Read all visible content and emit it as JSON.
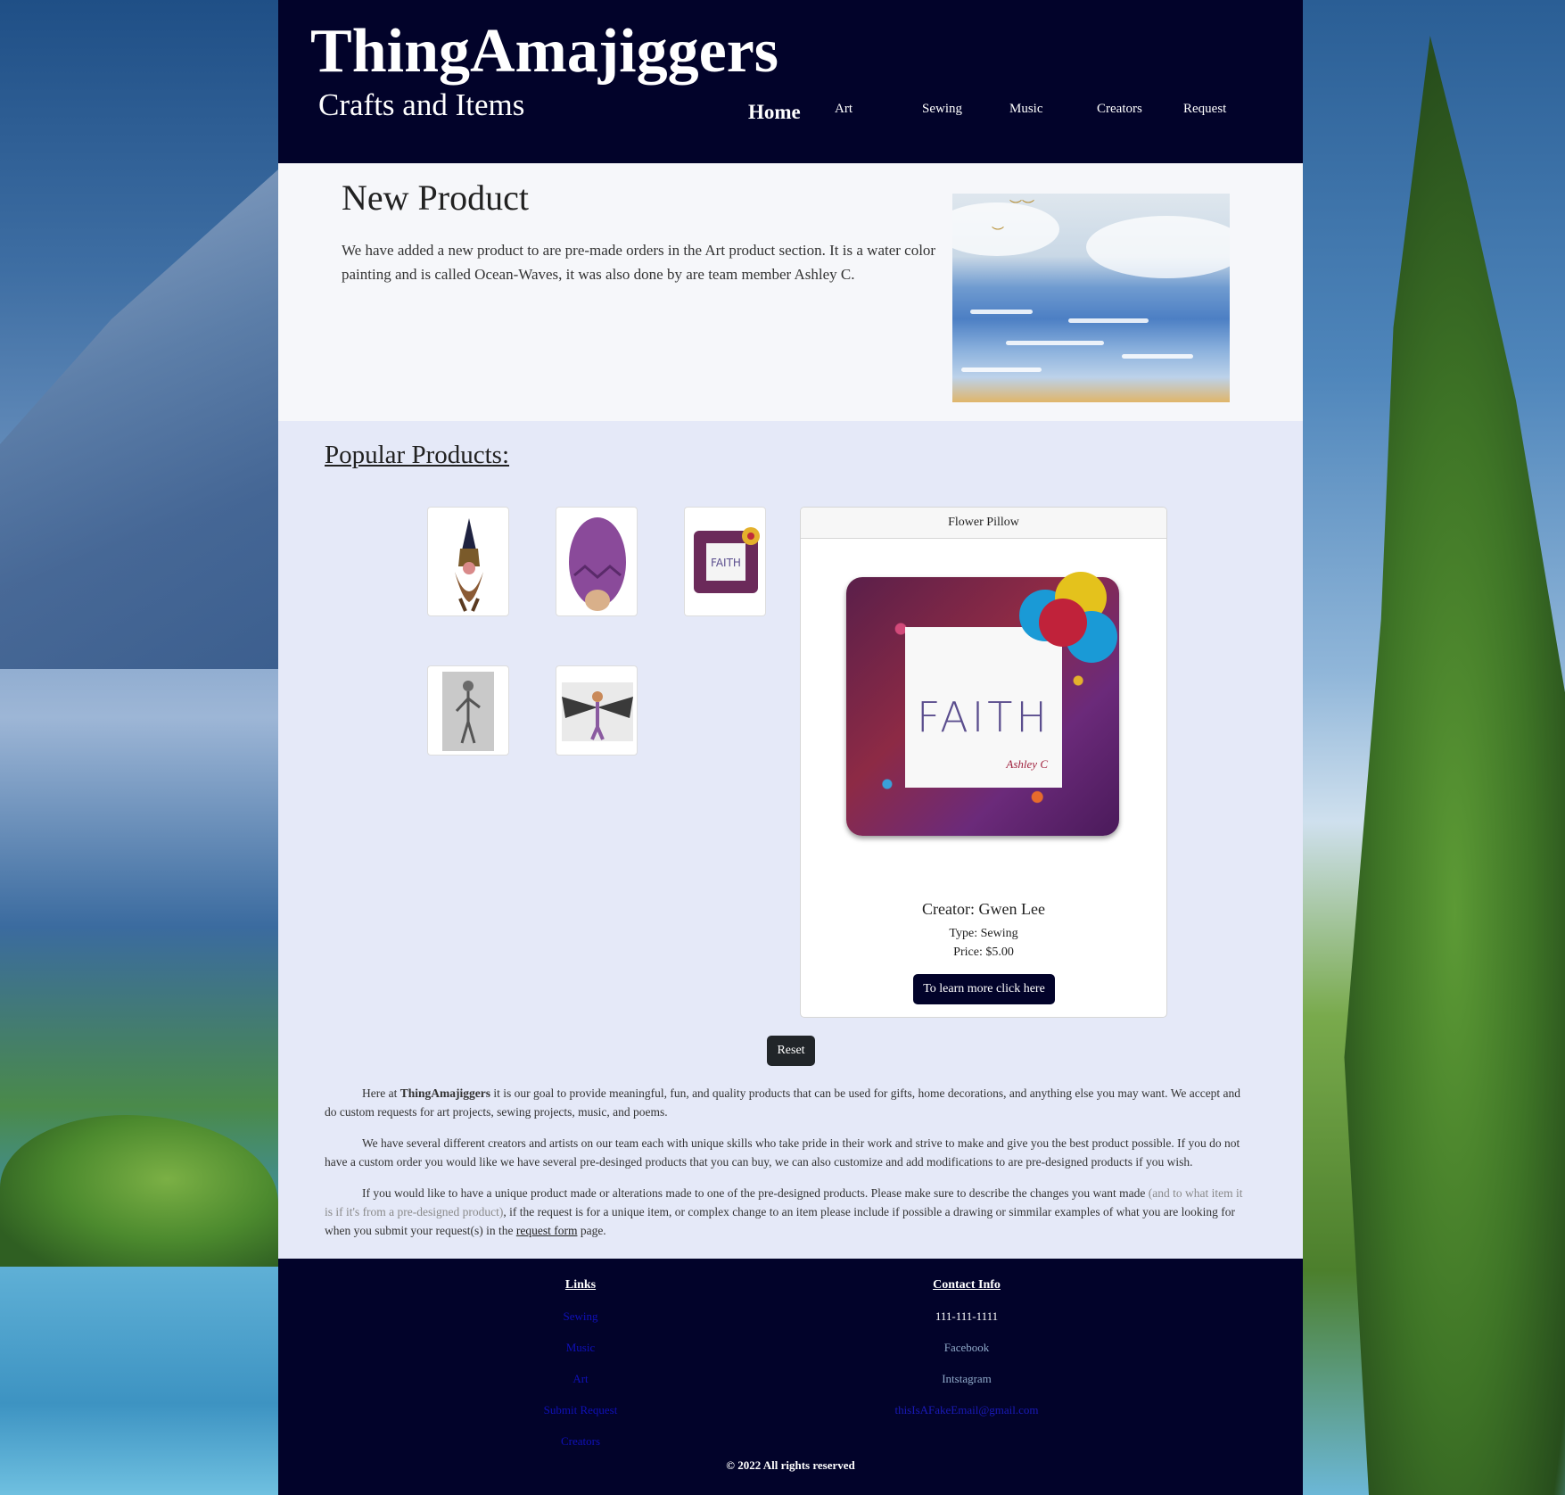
{
  "site": {
    "brand": "ThingAmajiggers",
    "tagline": "Crafts and Items"
  },
  "nav": {
    "home": "Home",
    "art": "Art",
    "sewing": "Sewing",
    "music": "Music",
    "creators": "Creators",
    "request": "Request"
  },
  "new_product": {
    "title": "New Product",
    "text": "We have added a new product to are pre-made orders in the Art product section. It is a water color painting and is called Ocean-Waves, it was also done by are team member Ashley C."
  },
  "popular": {
    "title": "Popular Products:",
    "thumbnail_icons": [
      "gnome-icon",
      "purple-plush-icon",
      "faith-pillow-icon",
      "knight-drawing-icon",
      "winged-figure-icon"
    ]
  },
  "card": {
    "header": "Flower Pillow",
    "pillow_word": "FAITH",
    "pillow_signature": "Ashley C",
    "creator": "Creator: Gwen Lee",
    "type": "Type: Sewing",
    "price": "Price: $5.00",
    "button": "To learn more click here"
  },
  "reset_label": "Reset",
  "about": {
    "p1_intro": "Here at ",
    "p1_brand": "ThingAmajiggers",
    "p1_rest": " it is our goal to provide meaningful, fun, and quality products that can be used for gifts, home decorations, and anything else you may want. We accept and do custom requests for art projects, sewing projects, music, and poems.",
    "p2": "We have several different creators and artists on our team each with unique skills who take pride in their work and strive to make and give you the best product possible. If you do not have a custom order you would like we have several pre-desinged products that you can buy, we can also customize and add modifications to are pre-designed products if you wish.",
    "p3_a": "If you would like to have a unique product made or alterations made to one of the pre-designed products. Please make sure to describe the changes you want made ",
    "p3_muted": "(and to what item it is if it's from a pre-designed product)",
    "p3_b": ", if the request is for a unique item, or complex change to an item please include if possible a drawing or simmilar examples of what you are looking for when you submit your request(s) in the ",
    "p3_link": "request form",
    "p3_c": " page."
  },
  "footer": {
    "links_heading": "Links",
    "links": [
      "Sewing",
      "Music",
      "Art",
      "Submit Request",
      "Creators"
    ],
    "contact_heading": "Contact Info",
    "phone": "111-111-1111",
    "facebook": "Facebook",
    "instagram": "Intstagram",
    "email": "thisIsAFakeEmail@gmail.com",
    "copyright": "© 2022 All rights reserved"
  },
  "colors": {
    "header_bg": "#02032a",
    "popular_bg": "#e5e9f8",
    "new_product_bg": "#f6f7fa",
    "link_blue": "#1010b8"
  }
}
